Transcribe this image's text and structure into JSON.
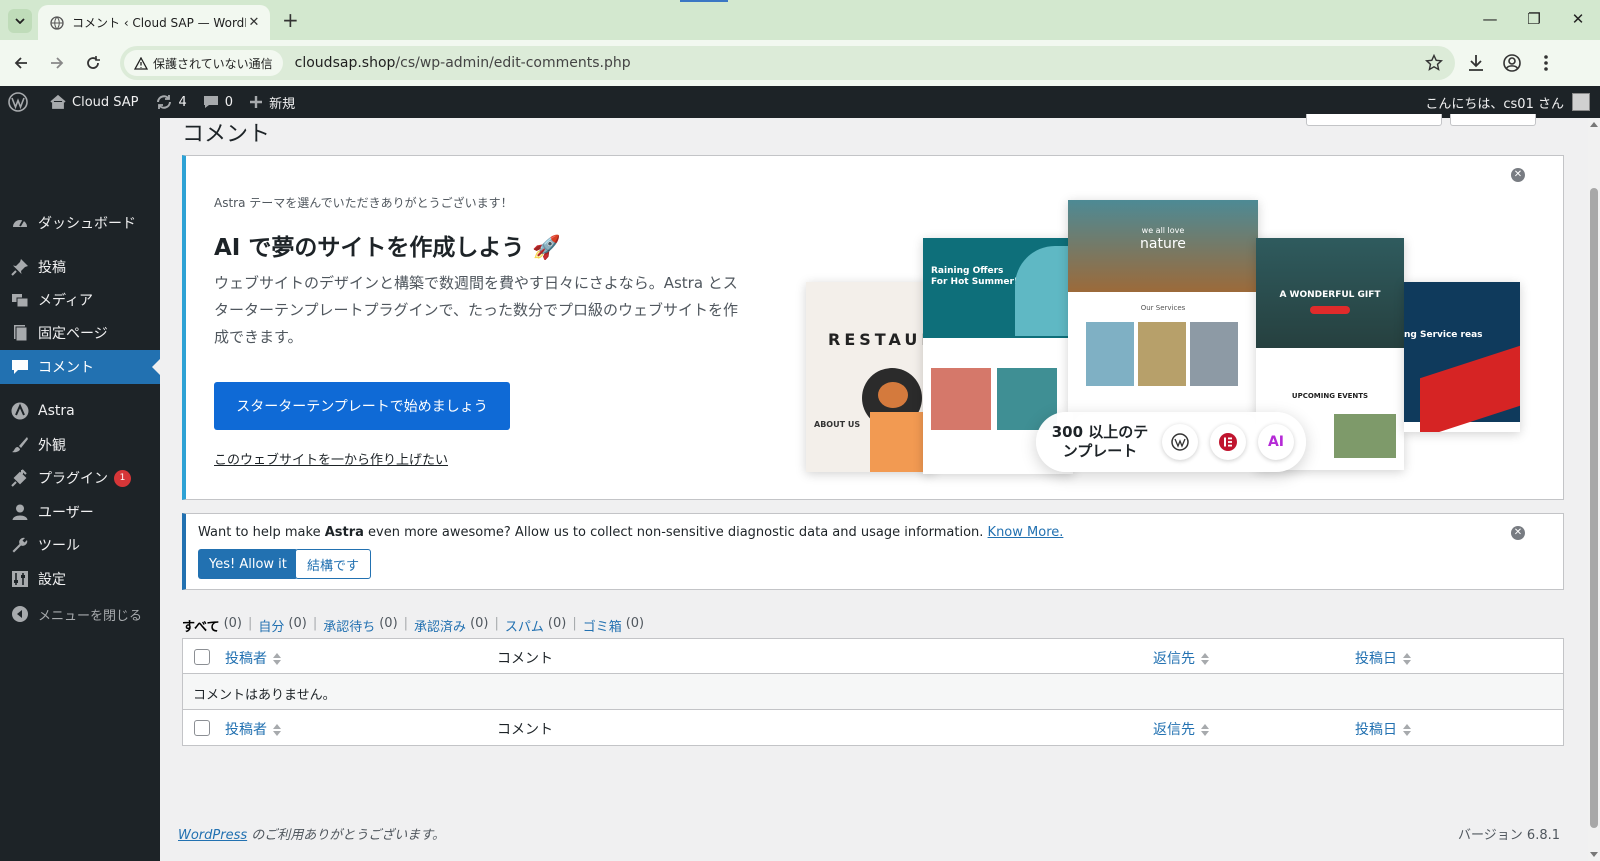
{
  "browser": {
    "tab_title": "コメント ‹ Cloud SAP — WordPress",
    "security_label": "保護されていない通信",
    "url_host": "cloudsap.shop",
    "url_path": "/cs/wp-admin/edit-comments.php"
  },
  "adminbar": {
    "site_name": "Cloud SAP",
    "updates_count": "4",
    "comments_count": "0",
    "new_label": "新規",
    "greeting": "こんにちは、cs01 さん"
  },
  "sidebar": {
    "items": [
      {
        "label": "ダッシュボード"
      },
      {
        "label": "投稿"
      },
      {
        "label": "メディア"
      },
      {
        "label": "固定ページ"
      },
      {
        "label": "コメント"
      },
      {
        "label": "Astra"
      },
      {
        "label": "外観"
      },
      {
        "label": "プラグイン",
        "badge": "1"
      },
      {
        "label": "ユーザー"
      },
      {
        "label": "ツール"
      },
      {
        "label": "設定"
      }
    ],
    "collapse_label": "メニューを閉じる"
  },
  "page": {
    "title": "コメント"
  },
  "astra_notice": {
    "subtitle": "Astra テーマを選んでいただきありがとうございます！",
    "title": "AI で夢のサイトを作成しよう 🚀",
    "description": "ウェブサイトのデザインと構築で数週間を費やす日々にさよなら。Astra とスターターテンプレートプラグインで、たった数分でプロ級のウェブサイトを作成できます。",
    "cta_label": "スターターテンプレートで始めましょう",
    "link_label": "このウェブサイトを一から作り上げたい",
    "collage": {
      "pill_text": "300 以上のテンプレート",
      "ai_label": "AI",
      "card_restaurant": "RESTAUR",
      "card_about": "ABOUT US",
      "card_offer": "Raining Offers For Hot Summer!",
      "card_nature": "nature",
      "card_nature_pre": "we all love",
      "card_services": "Our Services",
      "card_gift": "A WONDERFUL GIFT",
      "card_events": "UPCOMING EVENTS",
      "card_service": "ng Service reas",
      "card_roofing": "oofing"
    }
  },
  "usage_notice": {
    "text_before": "Want to help make ",
    "text_brand": "Astra",
    "text_after": " even more awesome? Allow us to collect non-sensitive diagnostic data and usage information. ",
    "link": "Know More.",
    "allow_label": "Yes! Allow it",
    "deny_label": "結構です"
  },
  "filters": [
    {
      "label": "すべて",
      "count": "(0)"
    },
    {
      "label": "自分",
      "count": "(0)"
    },
    {
      "label": "承認待ち",
      "count": "(0)"
    },
    {
      "label": "承認済み",
      "count": "(0)"
    },
    {
      "label": "スパム",
      "count": "(0)"
    },
    {
      "label": "ゴミ箱",
      "count": "(0)"
    }
  ],
  "table": {
    "col_author": "投稿者",
    "col_comment": "コメント",
    "col_response": "返信先",
    "col_date": "投稿日",
    "empty_message": "コメントはありません。"
  },
  "footer": {
    "wp_link": "WordPress",
    "thanks": " のご利用ありがとうございます。",
    "version": "バージョン 6.8.1"
  },
  "colors": {
    "admin_dark": "#1d2327",
    "wp_blue": "#2271b1",
    "astra_cta": "#0f6ad6",
    "badge_red": "#d63638",
    "browser_green": "#d3e8cf"
  }
}
